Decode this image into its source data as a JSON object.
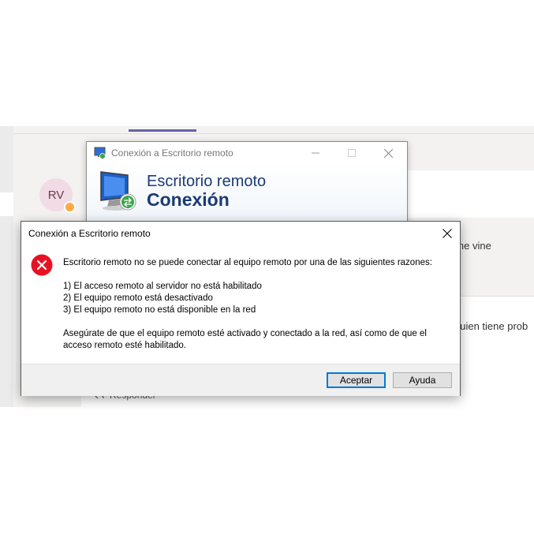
{
  "background": {
    "avatar_initials": "RV",
    "message_1": "er  y me vine",
    "message_2": "guien tiene prob",
    "reply_label": "Responder"
  },
  "rdp_window": {
    "title": "Conexión a Escritorio remoto",
    "heading_line1": "Escritorio remoto",
    "heading_line2": "Conexión"
  },
  "dialog": {
    "title": "Conexión a Escritorio remoto",
    "message": "Escritorio remoto no se puede conectar al equipo remoto por una de las siguientes razones:",
    "reasons": [
      "1) El acceso remoto al servidor no está habilitado",
      "2) El equipo remoto está desactivado",
      "3) El equipo remoto no está disponible en la red"
    ],
    "advice": "Asegúrate de que el equipo remoto esté activado y conectado a la red, así como de que el acceso remoto esté habilitado.",
    "buttons": {
      "ok": "Aceptar",
      "help": "Ayuda"
    }
  },
  "colors": {
    "error_red": "#e81123",
    "accent_blue": "#0078d7",
    "teams_purple": "#6264a7"
  }
}
